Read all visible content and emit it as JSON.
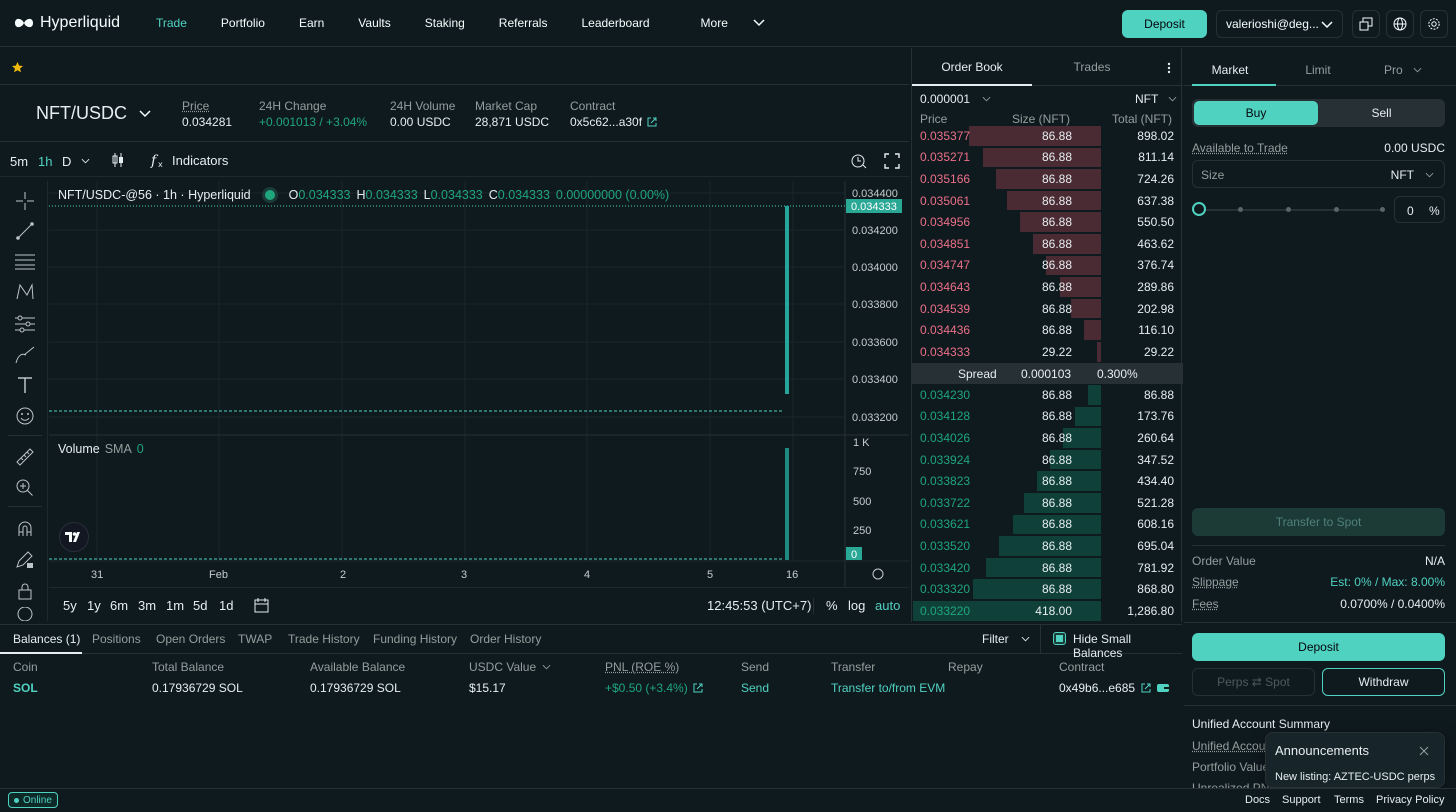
{
  "header": {
    "logo_text": "Hyperliquid",
    "nav": [
      "Trade",
      "Portfolio",
      "Earn",
      "Vaults",
      "Staking",
      "Referrals",
      "Leaderboard",
      "More"
    ],
    "deposit_label": "Deposit",
    "account_label": "valerioshi@deg..."
  },
  "market": {
    "pair": "NFT/USDC",
    "price_label": "Price",
    "price_value": "0.034281",
    "change_label": "24H Change",
    "change_value": "+0.001013 / +3.04%",
    "volume_label": "24H Volume",
    "volume_value": "0.00 USDC",
    "mcap_label": "Market Cap",
    "mcap_value": "28,871 USDC",
    "contract_label": "Contract",
    "contract_value": "0x5c62...a30f"
  },
  "chart_toolbar": {
    "intervals": [
      "5m",
      "1h",
      "D"
    ],
    "indicators_label": "Indicators"
  },
  "chart": {
    "legend_title": "NFT/USDC-@56 · 1h · Hyperliquid",
    "ohlc": {
      "o_label": "O",
      "o": "0.034333",
      "h_label": "H",
      "h": "0.034333",
      "l_label": "L",
      "l": "0.034333",
      "c_label": "C",
      "c": "0.034333",
      "chg": "0.00000000 (0.00%)"
    },
    "price_ticks": [
      "0.034400",
      "0.034200",
      "0.034000",
      "0.033800",
      "0.033600",
      "0.033400",
      "0.033200"
    ],
    "last_price_tag": "0.034333",
    "volume_label": "Volume",
    "volume_sma": "SMA",
    "volume_val": "0",
    "volume_ticks": [
      "1 K",
      "750",
      "500",
      "250"
    ],
    "volume_zero_tag": "0",
    "x_ticks": [
      "31",
      "Feb",
      "2",
      "3",
      "4",
      "5",
      "16"
    ],
    "ranges": [
      "5y",
      "1y",
      "6m",
      "3m",
      "1m",
      "5d",
      "1d"
    ],
    "time": "12:45:53 (UTC+7)",
    "pct": "%",
    "log": "log",
    "auto": "auto"
  },
  "orderbook": {
    "tabs": [
      "Order Book",
      "Trades"
    ],
    "tick": "0.000001",
    "unit": "NFT",
    "headers": [
      "Price",
      "Size (NFT)",
      "Total (NFT)"
    ],
    "asks": [
      {
        "p": "0.035377",
        "s": "86.88",
        "t": "898.02",
        "d": 0.7
      },
      {
        "p": "0.035271",
        "s": "86.88",
        "t": "811.14",
        "d": 0.63
      },
      {
        "p": "0.035166",
        "s": "86.88",
        "t": "724.26",
        "d": 0.56
      },
      {
        "p": "0.035061",
        "s": "86.88",
        "t": "637.38",
        "d": 0.5
      },
      {
        "p": "0.034956",
        "s": "86.88",
        "t": "550.50",
        "d": 0.43
      },
      {
        "p": "0.034851",
        "s": "86.88",
        "t": "463.62",
        "d": 0.36
      },
      {
        "p": "0.034747",
        "s": "86.88",
        "t": "376.74",
        "d": 0.29
      },
      {
        "p": "0.034643",
        "s": "86.88",
        "t": "289.86",
        "d": 0.22
      },
      {
        "p": "0.034539",
        "s": "86.88",
        "t": "202.98",
        "d": 0.16
      },
      {
        "p": "0.034436",
        "s": "86.88",
        "t": "116.10",
        "d": 0.09
      },
      {
        "p": "0.034333",
        "s": "29.22",
        "t": "29.22",
        "d": 0.02
      }
    ],
    "spread_label": "Spread",
    "spread_value": "0.000103",
    "spread_pct": "0.300%",
    "bids": [
      {
        "p": "0.034230",
        "s": "86.88",
        "t": "86.88",
        "d": 0.07
      },
      {
        "p": "0.034128",
        "s": "86.88",
        "t": "173.76",
        "d": 0.14
      },
      {
        "p": "0.034026",
        "s": "86.88",
        "t": "260.64",
        "d": 0.2
      },
      {
        "p": "0.033924",
        "s": "86.88",
        "t": "347.52",
        "d": 0.27
      },
      {
        "p": "0.033823",
        "s": "86.88",
        "t": "434.40",
        "d": 0.34
      },
      {
        "p": "0.033722",
        "s": "86.88",
        "t": "521.28",
        "d": 0.41
      },
      {
        "p": "0.033621",
        "s": "86.88",
        "t": "608.16",
        "d": 0.47
      },
      {
        "p": "0.033520",
        "s": "86.88",
        "t": "695.04",
        "d": 0.54
      },
      {
        "p": "0.033420",
        "s": "86.88",
        "t": "781.92",
        "d": 0.61
      },
      {
        "p": "0.033320",
        "s": "86.88",
        "t": "868.80",
        "d": 0.68
      },
      {
        "p": "0.033220",
        "s": "418.00",
        "t": "1,286.80",
        "d": 1.0
      }
    ]
  },
  "trade": {
    "tabs": [
      "Market",
      "Limit",
      "Pro"
    ],
    "buy": "Buy",
    "sell": "Sell",
    "available_label": "Available to Trade",
    "available_value": "0.00 USDC",
    "size_placeholder": "Size",
    "size_unit": "NFT",
    "pct_value": "0",
    "pct_sign": "%",
    "transfer_btn": "Transfer to Spot",
    "order_value_label": "Order Value",
    "order_value": "N/A",
    "slippage_label": "Slippage",
    "slippage_value": "Est: 0% / Max: 8.00%",
    "fees_label": "Fees",
    "fees_value": "0.0700% / 0.0400%",
    "deposit": "Deposit",
    "perps_spot": "Perps ⇄ Spot",
    "withdraw": "Withdraw",
    "summary_title": "Unified Account Summary",
    "summary_rows": [
      "Unified Accoun",
      "Portfolio Value",
      "Unrealized PNL"
    ]
  },
  "announcement": {
    "title": "Announcements",
    "text": "New listing: AZTEC-USDC perps"
  },
  "bottom": {
    "tabs": [
      "Balances (1)",
      "Positions",
      "Open Orders",
      "TWAP",
      "Trade History",
      "Funding History",
      "Order History"
    ],
    "filter": "Filter",
    "hide_small": "Hide Small Balances",
    "columns": [
      "Coin",
      "Total Balance",
      "Available Balance",
      "USDC Value",
      "PNL (ROE %)",
      "Send",
      "Transfer",
      "Repay",
      "Contract"
    ],
    "row": {
      "coin": "SOL",
      "total": "0.17936729 SOL",
      "avail": "0.17936729 SOL",
      "usdc": "$15.17",
      "pnl": "+$0.50 (+3.4%)",
      "send": "Send",
      "transfer": "Transfer to/from EVM",
      "contract": "0x49b6...e685"
    }
  },
  "footer": {
    "online": "Online",
    "links": [
      "Docs",
      "Support",
      "Terms",
      "Privacy Policy"
    ]
  },
  "colors": {
    "accent": "#50d2c1",
    "ask": "#ed7088",
    "bid": "#1fa67d",
    "bg": "#0f1a1f"
  }
}
